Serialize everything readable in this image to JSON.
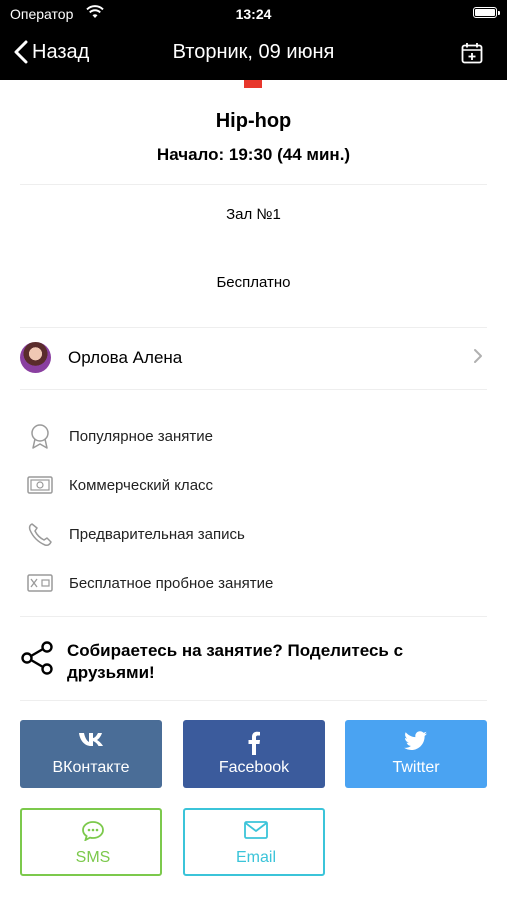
{
  "status_bar": {
    "carrier": "Оператор",
    "time": "13:24"
  },
  "nav": {
    "back_label": "Назад",
    "title": "Вторник, 09 июня"
  },
  "event": {
    "name": "Hip-hop",
    "start": "Начало: 19:30 (44 мин.)",
    "hall": "Зал №1",
    "price": "Бесплатно"
  },
  "trainer": {
    "name": "Орлова Алена"
  },
  "features": [
    {
      "label": "Популярное занятие",
      "icon": "award-icon"
    },
    {
      "label": "Коммерческий класс",
      "icon": "banknote-icon"
    },
    {
      "label": "Предварительная запись",
      "icon": "phone-icon"
    },
    {
      "label": "Бесплатное пробное занятие",
      "icon": "wallet-icon"
    }
  ],
  "share": {
    "text": "Собираетесь на занятие? Поделитесь с друзьями!",
    "buttons": [
      {
        "label": "ВКонтакте",
        "icon": "vk-icon",
        "color": "#4a6d97"
      },
      {
        "label": "Facebook",
        "icon": "facebook-icon",
        "color": "#3b5b9c"
      },
      {
        "label": "Twitter",
        "icon": "twitter-icon",
        "color": "#4aa3f2"
      },
      {
        "label": "SMS",
        "icon": "sms-icon",
        "color": "#7cc94c"
      },
      {
        "label": "Email",
        "icon": "email-icon",
        "color": "#3bc4d9"
      }
    ]
  },
  "colors": {
    "bar": "#000000",
    "accent_red": "#e8372c"
  }
}
